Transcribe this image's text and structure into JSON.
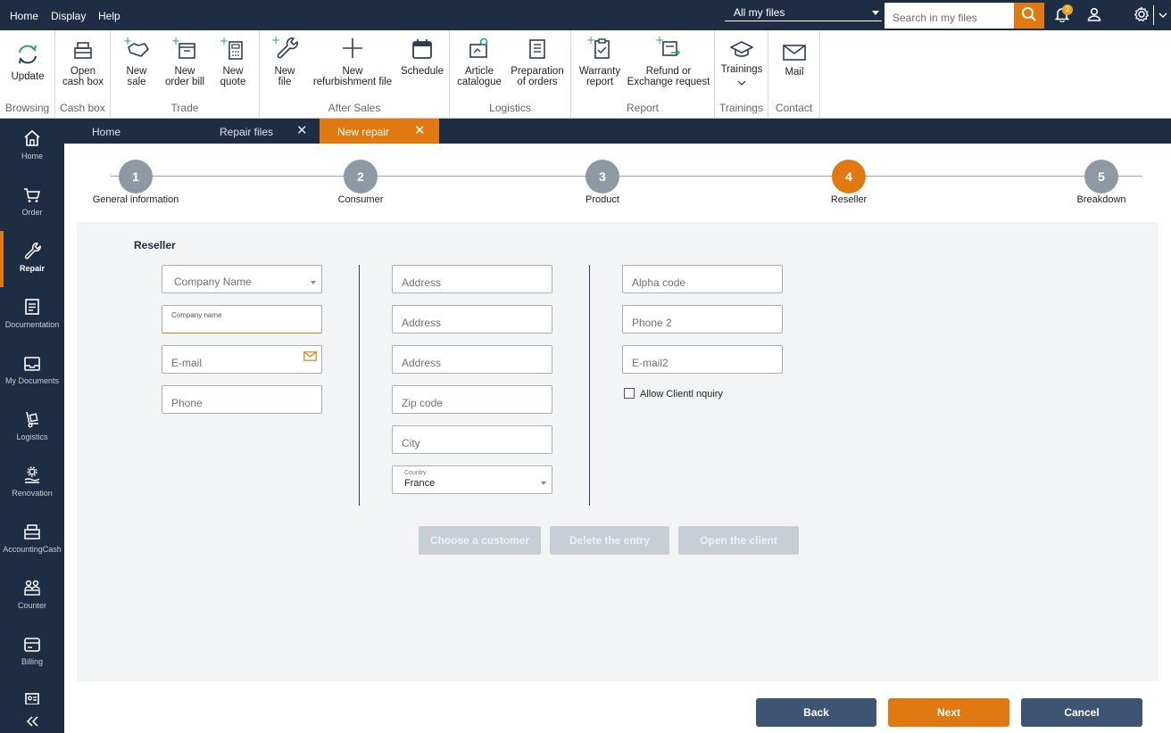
{
  "menu": {
    "home": "Home",
    "display": "Display",
    "help": "Help"
  },
  "file_scope": {
    "value": "All my files"
  },
  "search": {
    "placeholder": "Search in my files"
  },
  "notifications": {
    "count": "2"
  },
  "ribbon": {
    "groups": {
      "browsing": "Browsing",
      "cashbox": "Cash box",
      "trade": "Trade",
      "aftersales": "After Sales",
      "logistics": "Logistics",
      "report": "Report",
      "trainings": "Trainings",
      "contact": "Contact"
    },
    "buttons": {
      "update": "Update",
      "open_cash_box": "Open\ncash box",
      "new_sale": "New\nsale",
      "new_order_bill": "New\norder bill",
      "new_quote": "New\nquote",
      "new_file": "New\nfile",
      "new_refurb": "New\nrefurbishment file",
      "schedule": "Schedule",
      "article_catalogue": "Article\ncatalogue",
      "prep_orders": "Preparation\nof orders",
      "warranty_report": "Warranty\nreport",
      "refund": "Refund or\nExchange request",
      "trainings": "Trainings",
      "mail": "Mail"
    }
  },
  "tabs": [
    {
      "label": "Home"
    },
    {
      "label": "Repair files"
    },
    {
      "label": "New repair"
    }
  ],
  "sidebar": {
    "items": [
      {
        "label": "Home"
      },
      {
        "label": "Order"
      },
      {
        "label": "Repair"
      },
      {
        "label": "Documentation"
      },
      {
        "label": "My Documents"
      },
      {
        "label": "Logistics"
      },
      {
        "label": "Renovation"
      },
      {
        "label": "AccountingCash"
      },
      {
        "label": "Counter"
      },
      {
        "label": "Billing"
      }
    ]
  },
  "stepper": {
    "steps": [
      {
        "num": "1",
        "label": "General information"
      },
      {
        "num": "2",
        "label": "Consumer"
      },
      {
        "num": "3",
        "label": "Product"
      },
      {
        "num": "4",
        "label": "Reseller"
      },
      {
        "num": "5",
        "label": "Breakdown"
      }
    ],
    "active_step": 4
  },
  "form": {
    "section_title": "Reseller",
    "company_select": "Company Name",
    "company_name_label": "Company name",
    "email": "E-mail",
    "phone": "Phone",
    "address1": "Address",
    "address2": "Address",
    "address3": "Address",
    "zip": "Zip code",
    "city": "City",
    "country_label": "Country",
    "country_value": "France",
    "alpha_code": "Alpha code",
    "phone2": "Phone 2",
    "email2": "E-mail2",
    "allow_inquiry": "Allow Clientl nquiry",
    "allow_inquiry_checked": false
  },
  "actions": {
    "choose_customer": "Choose a customer",
    "delete_entry": "Delete the entry",
    "open_client": "Open the client"
  },
  "footer": {
    "back": "Back",
    "next": "Next",
    "cancel": "Cancel"
  },
  "colors": {
    "navy": "#1d2e44",
    "accent": "#e07a10",
    "steel": "#3d5572",
    "step_inactive": "#8e99a4"
  }
}
